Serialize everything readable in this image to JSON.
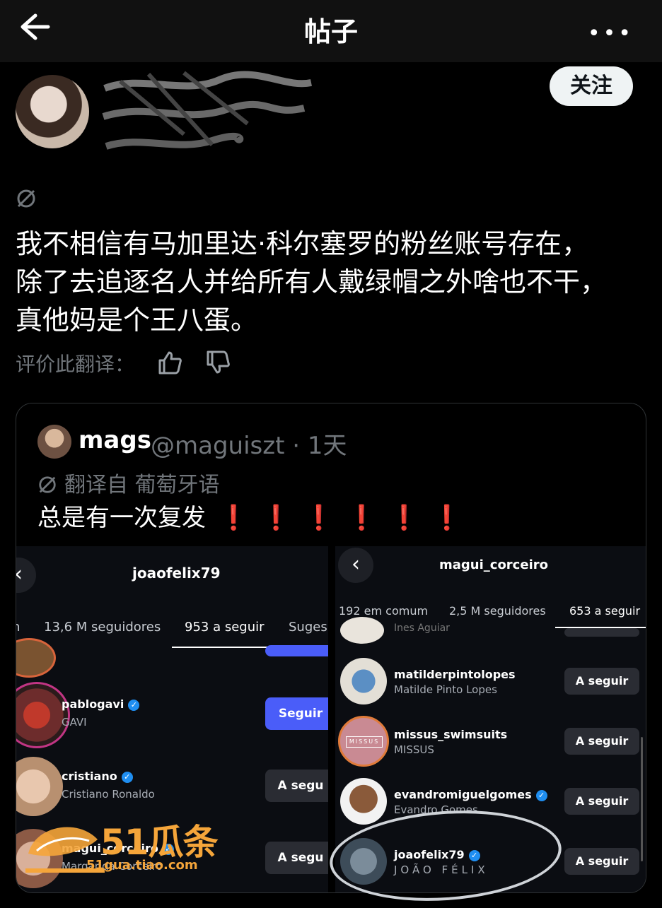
{
  "header": {
    "title": "帖子",
    "more": "•••"
  },
  "follow_label": "关注",
  "post": {
    "lines": [
      "我不相信有马加里达·科尔塞罗的粉丝账号存在，",
      "除了去追逐名人并给所有人戴绿帽之外啥也不干，",
      "真他妈是个王八蛋。"
    ],
    "rate_label": "评价此翻译："
  },
  "quote": {
    "name": "mags",
    "handle_line": "@maguiszt · 1天",
    "translated_from": "翻译自 葡萄牙语",
    "text": "总是有一次复发",
    "bangs": [
      "❗",
      "❗",
      "❗",
      "❗",
      "❗",
      "❗"
    ]
  },
  "left_shot": {
    "username": "joaofelix79",
    "tabs": [
      "n",
      "13,6 M seguidores",
      "953 a seguir",
      "Suges"
    ],
    "rows": [
      {
        "user": "pablogavi",
        "name": "GAVI",
        "button": "Seguir",
        "verified": true
      },
      {
        "user": "cristiano",
        "name": "Cristiano Ronaldo",
        "button": "A segu",
        "verified": true
      },
      {
        "user": "magui_corceiro",
        "name": "Margarida Corceiro",
        "button": "A segu",
        "verified": true
      }
    ]
  },
  "right_shot": {
    "username": "magui_corceiro",
    "tabs": [
      "192 em comum",
      "2,5 M seguidores",
      "653 a seguir"
    ],
    "partial_name": "Ines Aguiar",
    "rows": [
      {
        "user": "matilderpintolopes",
        "name": "Matilde Pinto Lopes",
        "button": "A seguir",
        "verified": false
      },
      {
        "user": "missus_swimsuits",
        "name": "MISSUS",
        "button": "A seguir",
        "verified": false,
        "logo_text": "MISSUS"
      },
      {
        "user": "evandromiguelgomes",
        "name": "Evandro Gomes",
        "button": "A seguir",
        "verified": true
      },
      {
        "user": "joaofelix79",
        "name": "JOÃO FÉLIX",
        "button": "A seguir",
        "verified": true
      }
    ]
  },
  "watermark": {
    "text": "51瓜条",
    "sub": "51gua.tiao.com"
  },
  "colors": {
    "accent_blue": "#4a5df9",
    "verified": "#1f8ef1",
    "alert_red": "#e0242b",
    "watermark": "#f5a53a"
  }
}
